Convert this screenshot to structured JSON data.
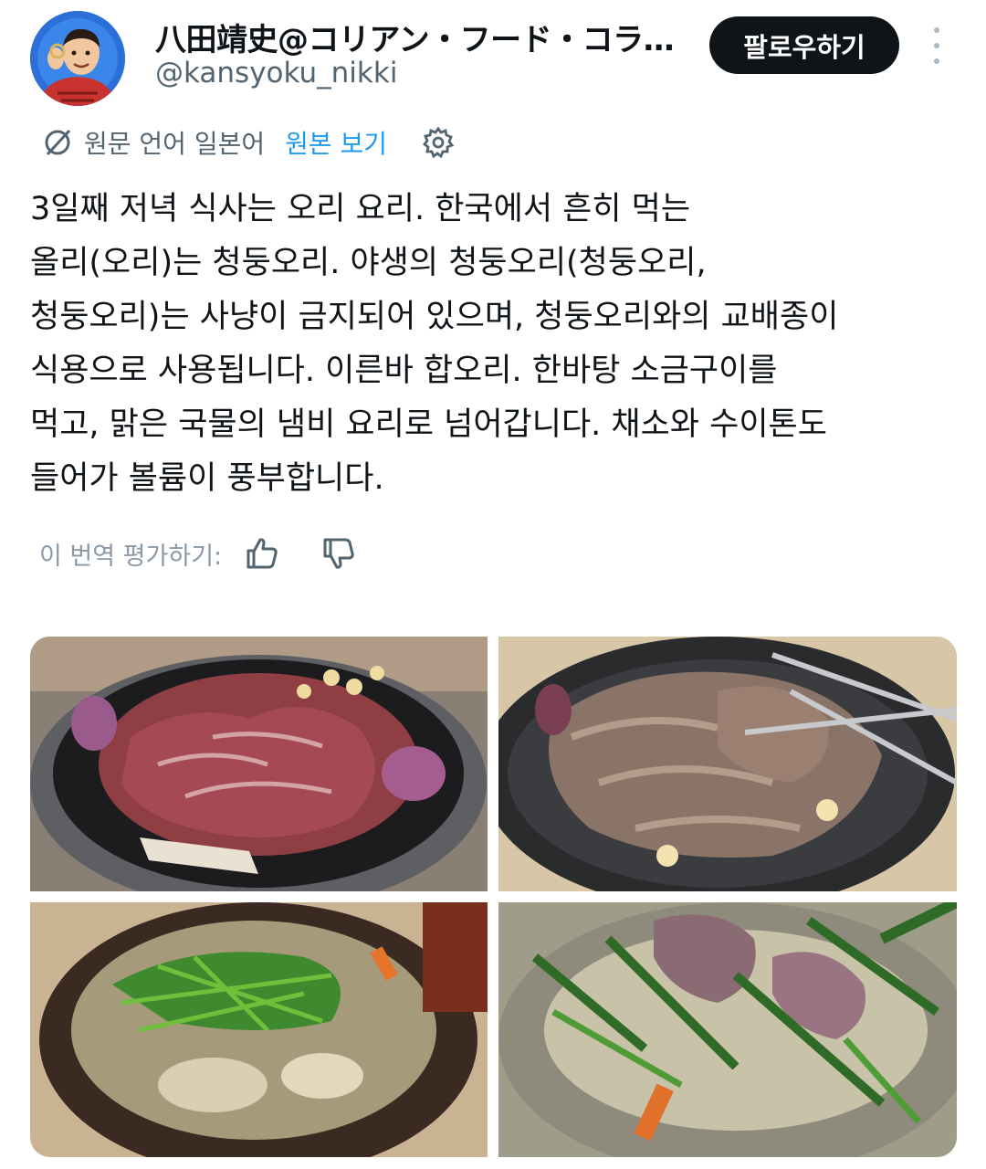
{
  "author": {
    "display_name": "八田靖史@コリアン・フード・コラ…",
    "handle": "@kansyoku_nikki",
    "avatar_icon": "profile-photo"
  },
  "follow_button": "팔로우하기",
  "more_icon": "more-vertical-icon",
  "translation": {
    "source_language": "원문 언어 일본어",
    "view_original": "원본 보기",
    "icon": "translate-icon",
    "settings_icon": "gear-icon"
  },
  "tweet_lines": [
    "3일째 저녁 식사는 오리 요리. 한국에서 흔히 먹는",
    "올리(오리)는 청둥오리. 야생의 청둥오리(청둥오리,",
    "청둥오리)는 사냥이 금지되어 있으며, 청둥오리와의 교배종이",
    "식용으로 사용됩니다. 이른바 합오리. 한바탕 소금구이를",
    "먹고, 맑은 국물의 냄비 요리로 넘어갑니다. 채소와 수이톤도",
    "들어가 볼륨이 풍부합니다."
  ],
  "rating": {
    "label": "이 번역 평가하기:",
    "like_icon": "thumbs-up-icon",
    "dislike_icon": "thumbs-down-icon"
  },
  "photos": [
    {
      "name": "raw-duck-on-grill-photo"
    },
    {
      "name": "grilled-duck-with-tongs-photo"
    },
    {
      "name": "duck-hotpot-photo"
    },
    {
      "name": "duck-soup-ladle-photo"
    }
  ],
  "colors": {
    "text": "#0f1419",
    "secondary": "#536471",
    "link": "#1d9bf0",
    "button_bg": "#0f1419"
  }
}
